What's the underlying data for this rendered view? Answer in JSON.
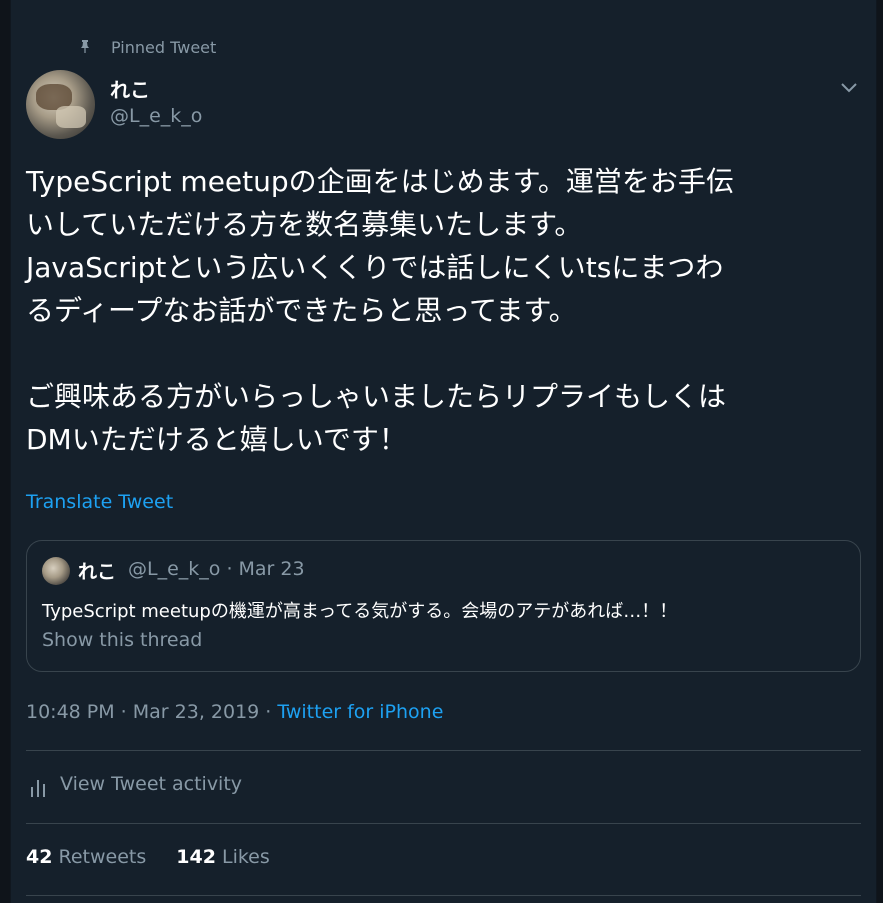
{
  "pinned": {
    "label": "Pinned Tweet",
    "icon": "pin-icon"
  },
  "author": {
    "name": "れこ",
    "handle": "@L_e_k_o"
  },
  "tweet": {
    "text": "TypeScript meetupの企画をはじめます。運営をお手伝\nいしていただける方を数名募集いたします。\nJavaScriptという広いくくりでは話しにくいtsにまつわ\nるディープなお話ができたらと思ってます。\n\nご興味ある方がいらっしゃいましたらリプライもしくは\nDMいただけると嬉しいです！",
    "translate_label": "Translate Tweet"
  },
  "quote": {
    "name": "れこ",
    "handle_date": "@L_e_k_o · Mar 23",
    "text": "TypeScript meetupの機運が高まってる気がする。会場のアテがあれば…！！",
    "show_thread": "Show this thread"
  },
  "meta": {
    "time_date": "10:48 PM · Mar 23, 2019 · ",
    "source": "Twitter for iPhone"
  },
  "activity": {
    "label": "View Tweet activity",
    "icon": "bar-chart-icon"
  },
  "stats": {
    "retweets_count": "42",
    "retweets_label": "Retweets",
    "likes_count": "142",
    "likes_label": "Likes"
  },
  "colors": {
    "background": "#15202b",
    "accent": "#1da1f2",
    "secondary_text": "#8899a6",
    "border": "#38444d"
  }
}
